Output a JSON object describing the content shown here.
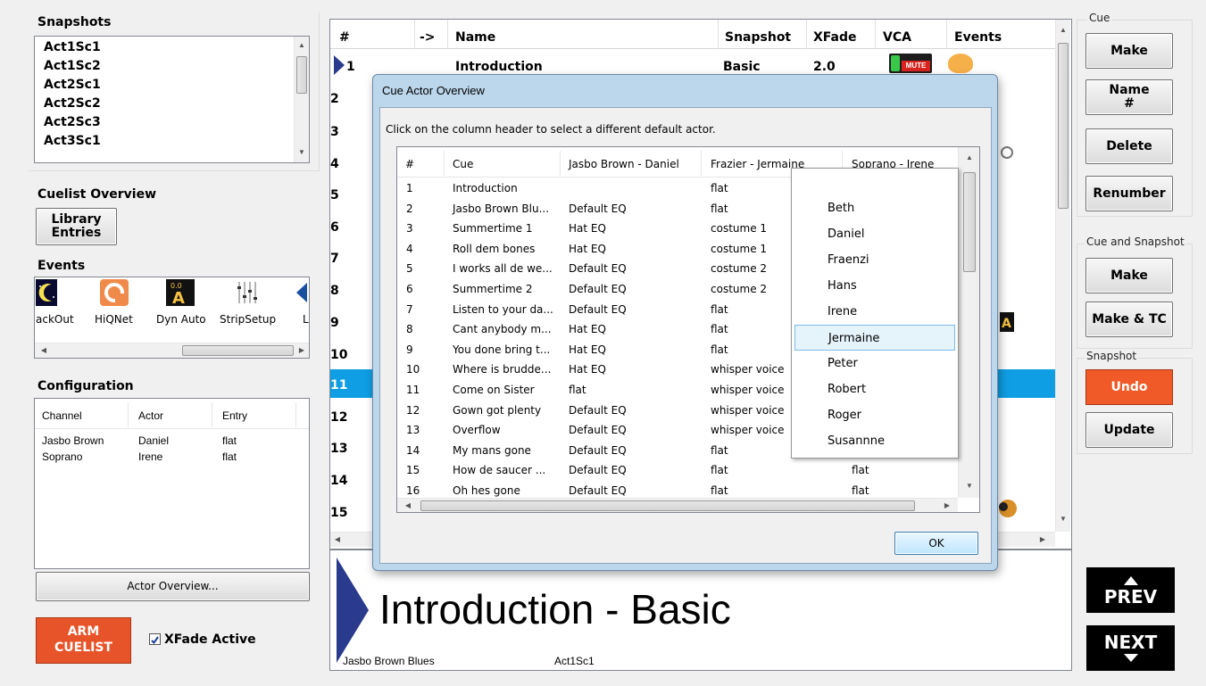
{
  "snapshots": {
    "title": "Snapshots",
    "items": [
      "Act1Sc1",
      "Act1Sc2",
      "Act2Sc1",
      "Act2Sc2",
      "Act2Sc3",
      "Act3Sc1"
    ]
  },
  "cuelist_overview": {
    "title": "Cuelist Overview",
    "library_button": "Library\nEntries"
  },
  "events": {
    "title": "Events",
    "items": [
      {
        "label": "BlackOut",
        "visible_label": "ackOut",
        "icon": "moon-icon"
      },
      {
        "label": "HiQNet",
        "icon": "hiqnet-icon"
      },
      {
        "label": "Dyn Auto",
        "icon": "dyn-auto-icon"
      },
      {
        "label": "StripSetup",
        "icon": "strip-setup-icon"
      },
      {
        "label": "L",
        "icon": "play-icon"
      }
    ]
  },
  "configuration": {
    "title": "Configuration",
    "headers": [
      "Channel",
      "Actor",
      "Entry"
    ],
    "rows": [
      [
        "Jasbo Brown",
        "Daniel",
        "flat"
      ],
      [
        "Soprano",
        "Irene",
        "flat"
      ]
    ],
    "actor_overview_button": "Actor Overview..."
  },
  "bottom_left": {
    "arm_button": "ARM\nCUELIST",
    "xfade_label": "XFade Active",
    "xfade_checked": true
  },
  "cue_grid": {
    "headers": [
      "#",
      "->",
      "Name",
      "Snapshot",
      "XFade",
      "VCA",
      "Events"
    ],
    "first_row": {
      "num": "1",
      "name": "Introduction",
      "snapshot": "Basic",
      "xfade": "2.0"
    },
    "row_numbers": [
      "1",
      "2",
      "3",
      "4",
      "5",
      "6",
      "7",
      "8",
      "9",
      "10",
      "11",
      "12",
      "13",
      "14",
      "15"
    ],
    "selected_row": "11",
    "vca_badge": "MUTE"
  },
  "right_panel": {
    "cue_section": "Cue",
    "make": "Make",
    "name_num": "Name\n#",
    "delete": "Delete",
    "renumber": "Renumber",
    "cue_snapshot_section": "Cue and Snapshot",
    "make2": "Make",
    "make_tc": "Make & TC",
    "snapshot_section": "Snapshot",
    "undo": "Undo",
    "update": "Update",
    "prev": "PREV",
    "next": "NEXT"
  },
  "preview": {
    "big_title": "Introduction - Basic",
    "footer_left": "Jasbo Brown Blues",
    "footer_right": "Act1Sc1"
  },
  "dialog": {
    "title": "Cue Actor Overview",
    "instruction": "Click on the column header to select a different default actor.",
    "headers": [
      "#",
      "Cue",
      "Jasbo Brown - Daniel",
      "Frazier - Jermaine",
      "Soprano - Irene"
    ],
    "rows": [
      [
        "1",
        "Introduction",
        "",
        "flat",
        ""
      ],
      [
        "2",
        "Jasbo Brown Blu...",
        "Default EQ",
        "flat",
        ""
      ],
      [
        "3",
        "Summertime 1",
        "Hat EQ",
        "costume 1",
        ""
      ],
      [
        "4",
        "Roll dem bones",
        "Hat EQ",
        "costume 1",
        ""
      ],
      [
        "5",
        "I works all de we...",
        "Default EQ",
        "costume 2",
        ""
      ],
      [
        "6",
        "Summertime 2",
        "Default EQ",
        "costume 2",
        ""
      ],
      [
        "7",
        "Listen to your da...",
        "Default EQ",
        "flat",
        ""
      ],
      [
        "8",
        "Cant anybody m...",
        "Hat EQ",
        "flat",
        ""
      ],
      [
        "9",
        "You done bring t...",
        "Hat EQ",
        "flat",
        ""
      ],
      [
        "10",
        "Where is brudde...",
        "Hat EQ",
        "whisper voice",
        ""
      ],
      [
        "11",
        "Come on Sister",
        "flat",
        "whisper voice",
        ""
      ],
      [
        "12",
        "Gown got plenty",
        "Default EQ",
        "whisper voice",
        ""
      ],
      [
        "13",
        "Overflow",
        "Default EQ",
        "whisper voice",
        ""
      ],
      [
        "14",
        "My mans gone",
        "Default EQ",
        "flat",
        "flat"
      ],
      [
        "15",
        "How de saucer ...",
        "Default EQ",
        "flat",
        "flat"
      ],
      [
        "16",
        "Oh hes gone",
        "Default EQ",
        "flat",
        "flat"
      ]
    ],
    "ok": "OK",
    "actor_menu": [
      "Beth",
      "Daniel",
      "Fraenzi",
      "Hans",
      "Irene",
      "Jermaine",
      "Peter",
      "Robert",
      "Roger",
      "Susannne"
    ],
    "highlighted_actor": "Jermaine"
  },
  "colors": {
    "selection_blue": "#0f9ee3",
    "arm_red": "#e8542a",
    "undo_red": "#f05a28",
    "dialog_frame": "#bcd6ec",
    "arrow_navy": "#2a3a8c"
  }
}
